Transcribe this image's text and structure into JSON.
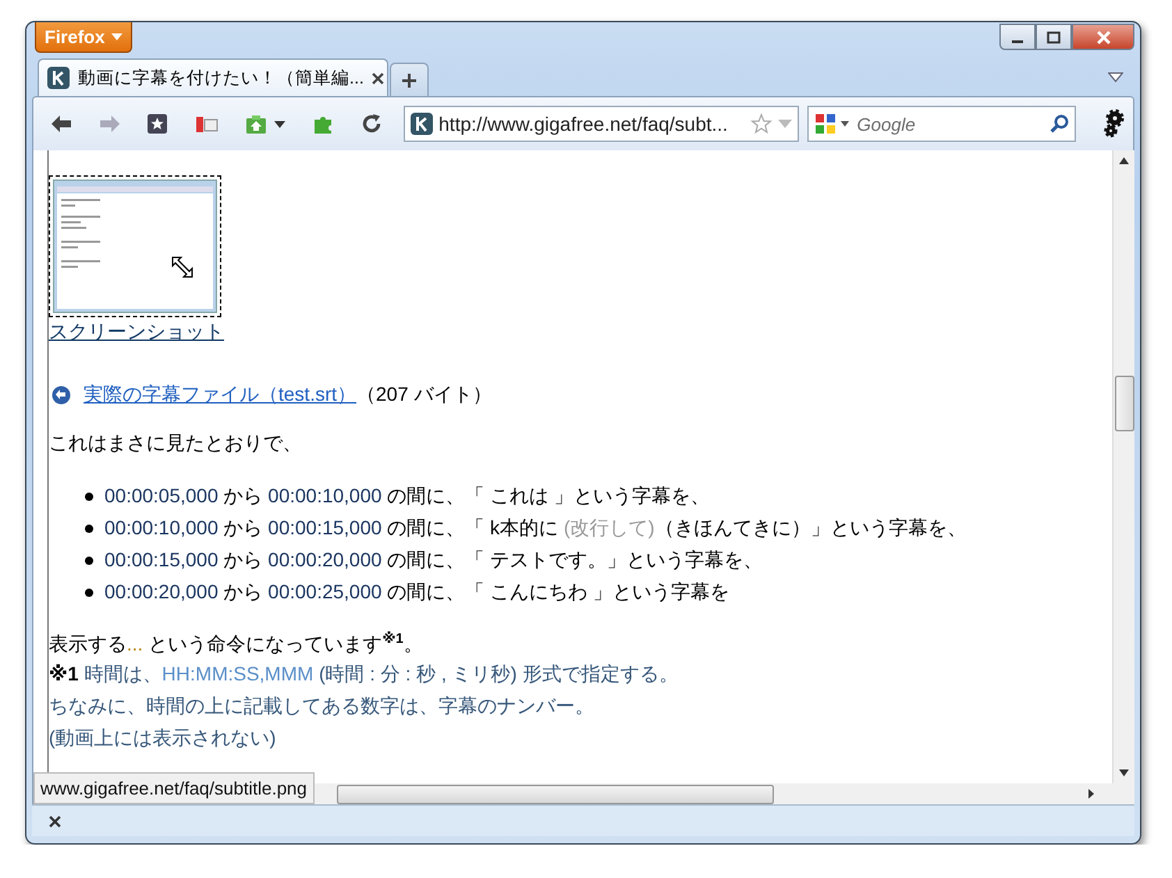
{
  "window": {
    "app_button": "Firefox"
  },
  "tabs": [
    {
      "title": "動画に字幕を付けたい！（簡単編...",
      "selected": true
    }
  ],
  "toolbar": {
    "url": "http://www.gigafree.net/faq/subt...",
    "search_placeholder": "Google"
  },
  "page": {
    "thumbnail_caption": "スクリーンショット",
    "file_link": "実際の字幕ファイル（test.srt）",
    "file_size": "（207 バイト）",
    "intro": "これはまさに見たとおりで、",
    "items": [
      [
        {
          "kind": "time",
          "text": "00:00:05,000"
        },
        {
          "kind": "plain",
          "text": " から "
        },
        {
          "kind": "time",
          "text": "00:00:10,000"
        },
        {
          "kind": "plain",
          "text": " の間に、「 これは 」という字幕を、"
        }
      ],
      [
        {
          "kind": "time",
          "text": "00:00:10,000"
        },
        {
          "kind": "plain",
          "text": " から "
        },
        {
          "kind": "time",
          "text": "00:00:15,000"
        },
        {
          "kind": "plain",
          "text": " の間に、「 k本的に "
        },
        {
          "kind": "muted",
          "text": "(改行して)"
        },
        {
          "kind": "plain",
          "text": "（きほんてきに）」という字幕を、"
        }
      ],
      [
        {
          "kind": "time",
          "text": "00:00:15,000"
        },
        {
          "kind": "plain",
          "text": " から "
        },
        {
          "kind": "time",
          "text": "00:00:20,000"
        },
        {
          "kind": "plain",
          "text": " の間に、「 テストです。」という字幕を、"
        }
      ],
      [
        {
          "kind": "time",
          "text": "00:00:20,000"
        },
        {
          "kind": "plain",
          "text": " から "
        },
        {
          "kind": "time",
          "text": "00:00:25,000"
        },
        {
          "kind": "plain",
          "text": " の間に、「 こんにちわ 」という字幕を"
        }
      ]
    ],
    "summary": [
      {
        "kind": "plain",
        "text": "表示する"
      },
      {
        "kind": "accent",
        "text": "..."
      },
      {
        "kind": "plain",
        "text": " という命令になっています"
      },
      {
        "kind": "sup",
        "text": "※1"
      },
      {
        "kind": "plain",
        "text": "。"
      }
    ],
    "notes": [
      [
        {
          "kind": "mark",
          "text": "※1"
        },
        {
          "kind": "note",
          "text": " 時間は、"
        },
        {
          "kind": "code",
          "text": "HH:MM:SS,MMM"
        },
        {
          "kind": "note",
          "text": " (時間 : 分 : 秒 , ミリ秒) 形式で指定する。"
        }
      ],
      [
        {
          "kind": "note",
          "text": "ちなみに、時間の上に記載してある数字は、字幕のナンバー。"
        }
      ],
      [
        {
          "kind": "note",
          "text": "(動画上には表示されない)"
        }
      ]
    ]
  },
  "status_tooltip": "www.gigafree.net/faq/subtitle.png"
}
